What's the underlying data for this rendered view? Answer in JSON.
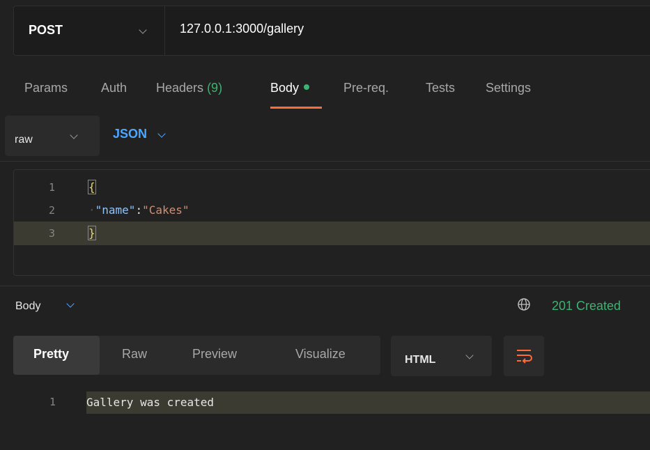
{
  "request": {
    "method": "POST",
    "url": "127.0.0.1:3000/gallery"
  },
  "request_tabs": {
    "params": "Params",
    "auth": "Auth",
    "headers": "Headers",
    "headers_count": "(9)",
    "body": "Body",
    "prereq": "Pre-req.",
    "tests": "Tests",
    "settings": "Settings"
  },
  "body_type": {
    "mode": "raw",
    "language": "JSON"
  },
  "editor": {
    "lines": [
      {
        "num": "1",
        "open": "{"
      },
      {
        "num": "2",
        "key": "\"name\"",
        "colon": ":",
        "value": "\"Cakes\""
      },
      {
        "num": "3",
        "close": "}"
      }
    ]
  },
  "response": {
    "section_label": "Body",
    "status": "201 Created",
    "view_tabs": [
      "Pretty",
      "Raw",
      "Preview",
      "Visualize"
    ],
    "format": "HTML",
    "lines": [
      {
        "num": "1",
        "text": "Gallery was created"
      }
    ]
  },
  "colors": {
    "accent": "#ff6c37",
    "success": "#3cb371",
    "link": "#4da6ff"
  }
}
